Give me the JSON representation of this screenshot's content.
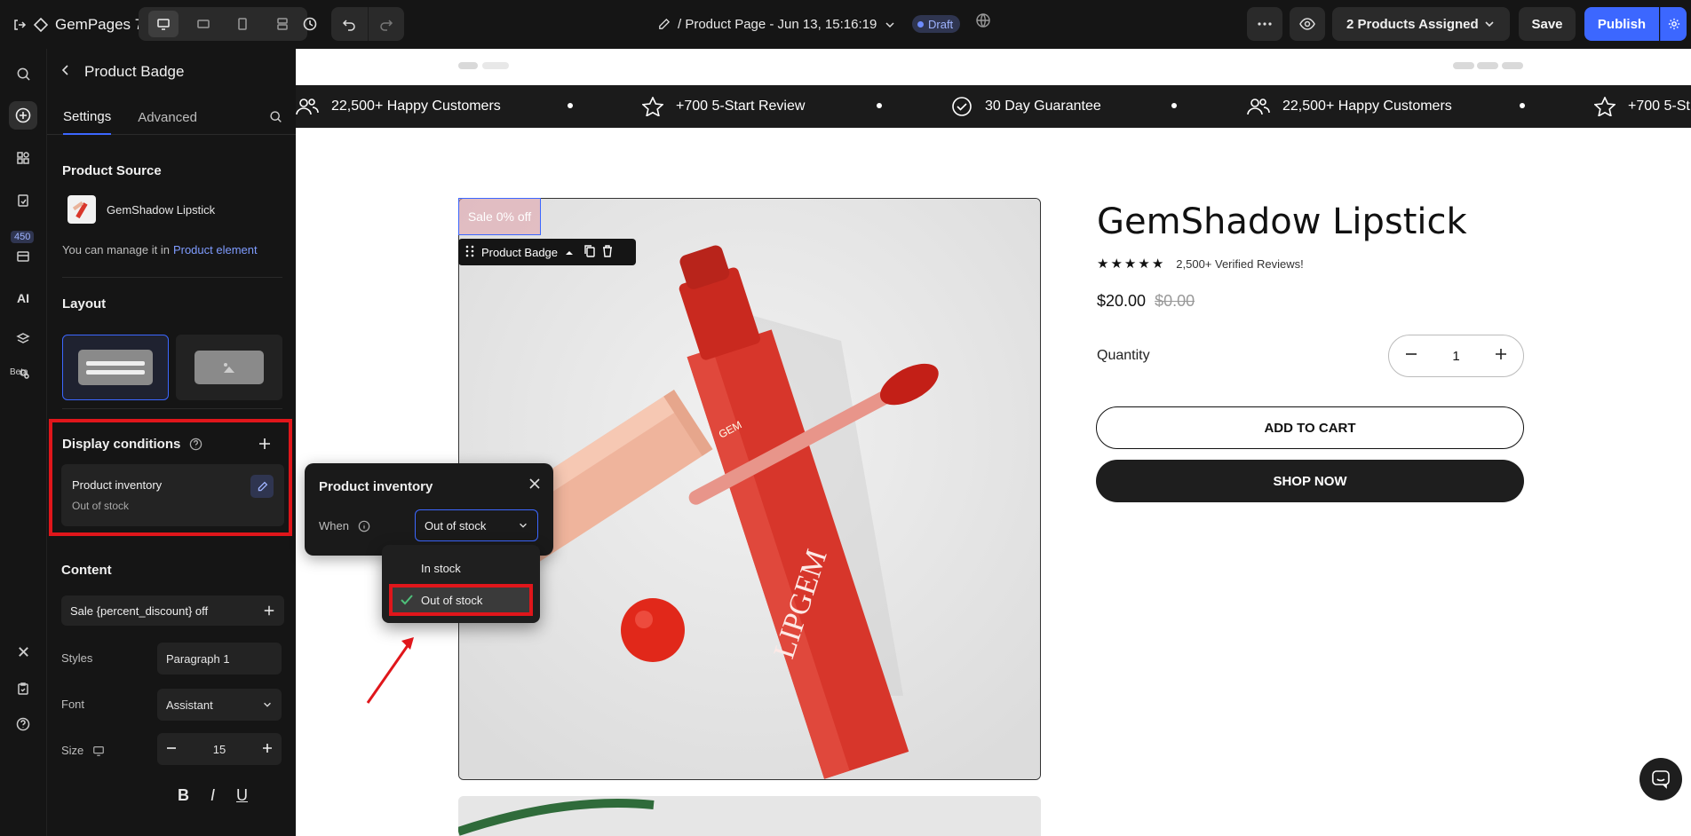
{
  "topbar": {
    "brand": "GemPages 7",
    "page_title": "/ Product Page - Jun 13, 15:16:19",
    "draft_label": "Draft",
    "assigned_label": "2 Products Assigned",
    "save_label": "Save",
    "publish_label": "Publish"
  },
  "rail": {
    "badge": "450",
    "beta": "Beta",
    "ai": "AI"
  },
  "panel": {
    "title": "Product Badge",
    "tabs": [
      "Settings",
      "Advanced"
    ],
    "product_source_title": "Product Source",
    "product_name": "GemShadow Lipstick",
    "manage_text": "You can manage it in",
    "manage_link": "Product element",
    "layout_title": "Layout",
    "display_conditions_title": "Display conditions",
    "condition": {
      "name": "Product inventory",
      "value": "Out of stock"
    },
    "content_title": "Content",
    "content_value": "Sale {percent_discount} off",
    "styles_label": "Styles",
    "styles_value": "Paragraph 1",
    "font_label": "Font",
    "font_value": "Assistant",
    "size_label": "Size",
    "size_value": "15"
  },
  "popover": {
    "title": "Product inventory",
    "when_label": "When",
    "selected": "Out of stock",
    "options": [
      "In stock",
      "Out of stock"
    ]
  },
  "canvas": {
    "marquee": [
      {
        "icon": "users-icon",
        "text": "22,500+ Happy Customers"
      },
      {
        "icon": "star-icon",
        "text": "+700 5-Start Review"
      },
      {
        "icon": "check-circle-icon",
        "text": "30 Day Guarantee"
      },
      {
        "icon": "users-icon",
        "text": "22,500+ Happy Customers"
      },
      {
        "icon": "star-icon",
        "text": "+700 5-St"
      }
    ],
    "badge_text": "Sale 0% off",
    "badge_tool_label": "Product Badge",
    "product_title": "GemShadow Lipstick",
    "reviews": "2,500+ Verified Reviews!",
    "price": "$20.00",
    "compare_price": "$0.00",
    "quantity_label": "Quantity",
    "quantity_value": "1",
    "add_to_cart": "ADD TO CART",
    "shop_now": "SHOP NOW",
    "tube_brand": "LIPGEM",
    "cap_brand": "GEM"
  },
  "colors": {
    "accent": "#3c67ff",
    "highlight": "#e0161b",
    "dark": "#151515"
  }
}
